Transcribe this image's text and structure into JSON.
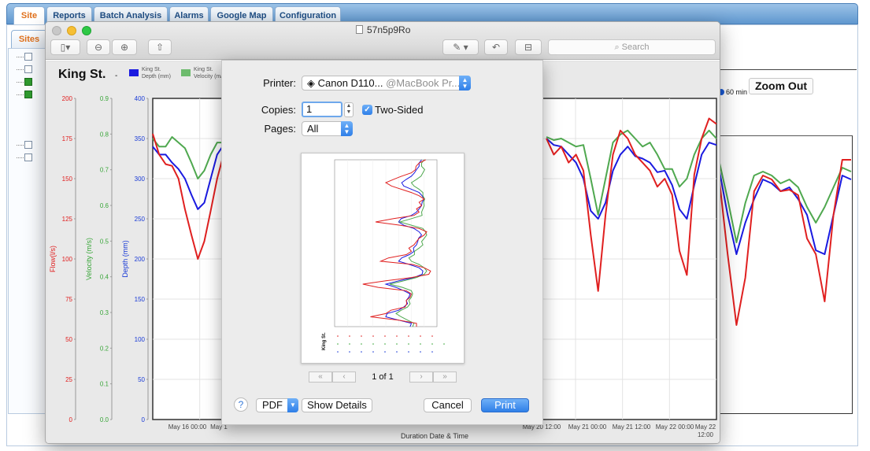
{
  "app": {
    "tabs": [
      {
        "label": "Site",
        "active": true
      },
      {
        "label": "Reports",
        "active": false
      },
      {
        "label": "Batch Analysis",
        "active": false
      },
      {
        "label": "Alarms",
        "active": false
      },
      {
        "label": "Google Map",
        "active": false
      },
      {
        "label": "Configuration",
        "active": false
      }
    ],
    "sites_tab": "Sites",
    "zoom_out": "Zoom Out",
    "interval_label": "60 min"
  },
  "window": {
    "title": "57n5p9Ro",
    "search_placeholder": "Search",
    "icons": [
      "sidebar-icon",
      "zoom-out-icon",
      "zoom-in-icon",
      "share-icon",
      "markup-icon",
      "rotate-icon",
      "toolbox-icon"
    ]
  },
  "chart_data": {
    "type": "line",
    "title": "King St.",
    "xlabel": "Duration Date & Time",
    "x_ticks_visible": [
      "May 16 00:00",
      "May 1",
      "May 20 12:00",
      "May 21 00:00",
      "May 21 12:00",
      "May 22 00:00",
      "May 22 12:00"
    ],
    "y_axes": [
      {
        "label": "Flow(l/s)",
        "color": "#e02020",
        "ticks": [
          "200",
          "175",
          "150",
          "125",
          "100",
          "75",
          "50",
          "25",
          "0"
        ]
      },
      {
        "label": "Velocity (m/s)",
        "color": "#3aa63a",
        "ticks": [
          "0.9",
          "0.8",
          "0.7",
          "0.6",
          "0.5",
          "0.4",
          "0.3",
          "0.2",
          "0.1",
          "0.0"
        ]
      },
      {
        "label": "Depth (mm)",
        "color": "#1a3bd6",
        "ticks": [
          "400",
          "350",
          "300",
          "250",
          "200",
          "150",
          "100",
          "50",
          "0"
        ]
      }
    ],
    "legend": [
      {
        "name": "King St. Depth (mm)",
        "color": "#1a1ae0"
      },
      {
        "name": "King St. Velocity (m/s)",
        "color": "#6dbb6d"
      }
    ],
    "ylim_depth": [
      0,
      400
    ],
    "grid": true,
    "series_left": [
      {
        "name": "depth",
        "color": "#1a1ae0",
        "values": [
          340,
          330,
          330,
          320,
          312,
          300,
          280,
          262,
          270,
          300,
          330,
          342
        ]
      },
      {
        "name": "velocity",
        "color": "#4fa84f",
        "values": [
          350,
          340,
          340,
          352,
          345,
          338,
          320,
          300,
          310,
          330,
          345,
          345
        ]
      },
      {
        "name": "flow",
        "color": "#e02020",
        "values": [
          356,
          330,
          318,
          316,
          300,
          262,
          230,
          200,
          222,
          260,
          300,
          330
        ]
      }
    ],
    "series_mid": [
      {
        "name": "depth",
        "color": "#1a1ae0",
        "values": [
          350,
          342,
          340,
          330,
          320,
          300,
          260,
          250,
          270,
          310,
          330,
          340,
          328,
          325,
          320,
          308,
          310,
          292,
          262,
          250,
          292,
          330,
          345,
          342
        ]
      },
      {
        "name": "velocity",
        "color": "#4fa84f",
        "values": [
          352,
          348,
          350,
          345,
          340,
          342,
          300,
          255,
          300,
          345,
          355,
          360,
          350,
          340,
          345,
          330,
          312,
          312,
          290,
          300,
          330,
          350,
          360,
          350
        ]
      },
      {
        "name": "flow",
        "color": "#e02020",
        "values": [
          350,
          330,
          340,
          320,
          330,
          310,
          230,
          160,
          255,
          330,
          360,
          350,
          330,
          320,
          310,
          290,
          300,
          280,
          210,
          180,
          305,
          350,
          375,
          368
        ]
      }
    ],
    "series_right": [
      {
        "name": "depth",
        "color": "#1a1ae0",
        "values": [
          310,
          250,
          200,
          240,
          270,
          295,
          290,
          280,
          285,
          270,
          250,
          205,
          200,
          250,
          300,
          295
        ]
      },
      {
        "name": "velocity",
        "color": "#4fa84f",
        "values": [
          320,
          270,
          215,
          265,
          300,
          305,
          300,
          290,
          295,
          285,
          260,
          240,
          260,
          285,
          310,
          305
        ]
      },
      {
        "name": "flow",
        "color": "#e02020",
        "values": [
          300,
          200,
          110,
          170,
          280,
          300,
          295,
          280,
          282,
          275,
          220,
          200,
          140,
          250,
          320,
          320
        ]
      }
    ]
  },
  "print_dialog": {
    "printer_label": "Printer:",
    "printer_name": "Canon D110...",
    "printer_host": "@MacBook Pr...",
    "copies_label": "Copies:",
    "copies_value": "1",
    "two_sided_label": "Two-Sided",
    "two_sided_checked": true,
    "pages_label": "Pages:",
    "pages_value": "All",
    "page_count": "1 of 1",
    "pdf_label": "PDF",
    "show_details_label": "Show Details",
    "cancel_label": "Cancel",
    "print_label": "Print"
  }
}
